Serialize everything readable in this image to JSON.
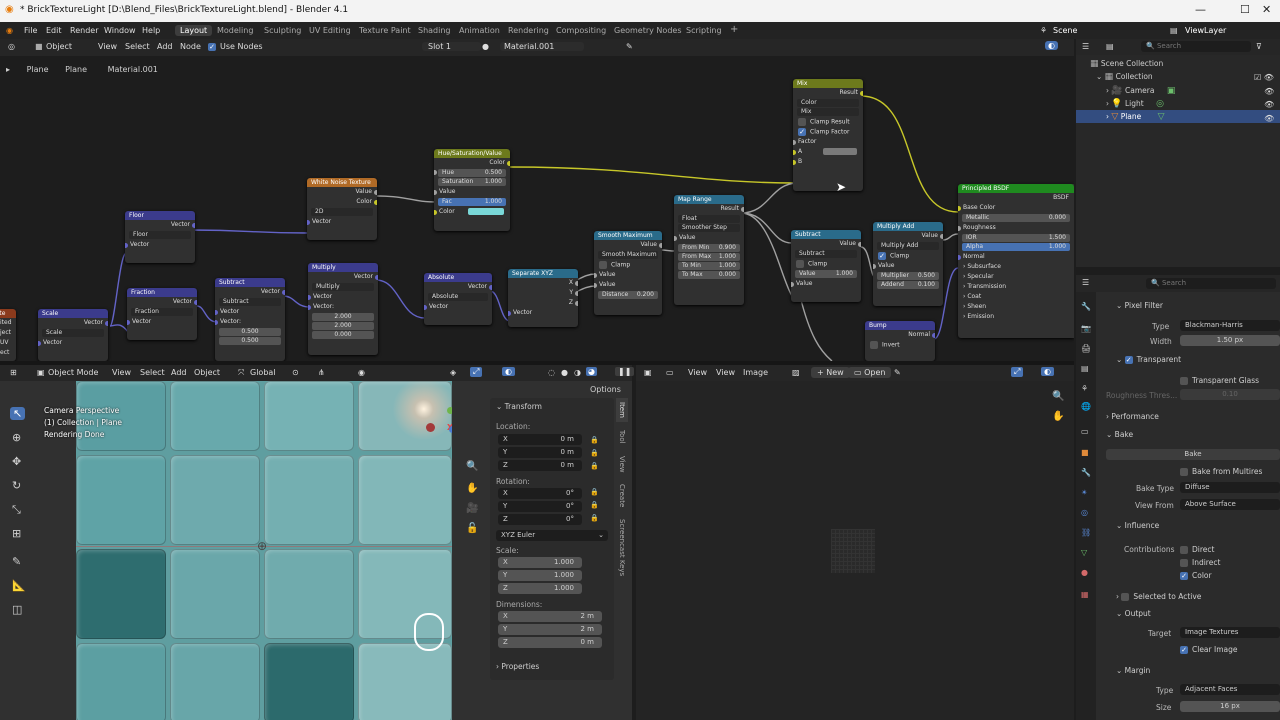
{
  "title_bar": {
    "title": "* BrickTextureLight [D:\\Blend_Files\\BrickTextureLight.blend] - Blender 4.1",
    "minimize": "—",
    "maximize": "☐",
    "close": "✕"
  },
  "menu": {
    "items": [
      "File",
      "Edit",
      "Render",
      "Window",
      "Help"
    ],
    "workspaces": [
      "Layout",
      "Modeling",
      "Sculpting",
      "UV Editing",
      "Texture Paint",
      "Shading",
      "Animation",
      "Rendering",
      "Compositing",
      "Geometry Nodes",
      "Scripting"
    ],
    "active_workspace": "Layout",
    "add_workspace": "+",
    "scene": "Scene",
    "view_layer": "ViewLayer"
  },
  "node_header": {
    "editor_type": "Object",
    "menus": [
      "View",
      "Select",
      "Add",
      "Node"
    ],
    "use_nodes_label": "Use Nodes",
    "slot": "Slot 1",
    "material": "Material.001"
  },
  "breadcrumb": {
    "items": [
      "Plane",
      "Plane",
      "Material.001"
    ]
  },
  "nodes": {
    "mix": {
      "title": "Mix",
      "result": "Result",
      "color": "Color",
      "mix": "Mix",
      "clamp_result": "Clamp Result",
      "clamp_factor": "Clamp Factor",
      "factor": "Factor",
      "a": "A",
      "b": "B"
    },
    "hsv": {
      "title": "Hue/Saturation/Value",
      "color_out": "Color",
      "hue": "Hue",
      "hue_v": "0.500",
      "sat": "Saturation",
      "sat_v": "1.000",
      "value": "Value",
      "fac": "Fac",
      "fac_v": "1.000",
      "color_in": "Color"
    },
    "white_noise": {
      "title": "White Noise Texture",
      "value": "Value",
      "color": "Color",
      "dim": "2D",
      "vector": "Vector"
    },
    "floor": {
      "title": "Floor",
      "vector_out": "Vector",
      "op": "Floor",
      "vector": "Vector"
    },
    "fraction": {
      "title": "Fraction",
      "vector_out": "Vector",
      "op": "Fraction",
      "vector": "Vector"
    },
    "subtract1": {
      "title": "Subtract",
      "vector_out": "Vector",
      "op": "Subtract",
      "vector": "Vector",
      "vector2": "Vector:",
      "v1": "0.500",
      "v2": "0.500"
    },
    "multiply": {
      "title": "Multiply",
      "vector_out": "Vector",
      "op": "Multiply",
      "vector": "Vector",
      "vector2": "Vector:",
      "v1": "2.000",
      "v2": "2.000",
      "v3": "0.000"
    },
    "absolute": {
      "title": "Absolute",
      "vector_out": "Vector",
      "op": "Absolute",
      "vector": "Vector"
    },
    "separate": {
      "title": "Separate XYZ",
      "x": "X",
      "y": "Y",
      "z": "Z",
      "vector": "Vector"
    },
    "smooth_max": {
      "title": "Smooth Maximum",
      "value_out": "Value",
      "op": "Smooth Maximum",
      "clamp": "Clamp",
      "value1": "Value",
      "value2": "Value",
      "distance": "Distance",
      "distance_v": "0.200"
    },
    "map_range": {
      "title": "Map Range",
      "result": "Result",
      "type": "Float",
      "interp": "Smoother Step",
      "value": "Value",
      "from_min": "From Min",
      "from_min_v": "0.900",
      "from_max": "From Max",
      "from_max_v": "1.000",
      "to_min": "To Min",
      "to_min_v": "1.000",
      "to_max": "To Max",
      "to_max_v": "0.000"
    },
    "subtract2": {
      "title": "Subtract",
      "value_out": "Value",
      "op": "Subtract",
      "clamp": "Clamp",
      "value": "Value",
      "value_v": "1.000",
      "value2": "Value"
    },
    "multiply_add": {
      "title": "Multiply Add",
      "value_out": "Value",
      "op": "Multiply Add",
      "clamp": "Clamp",
      "value": "Value",
      "mult": "Multiplier",
      "mult_v": "0.500",
      "addend": "Addend",
      "addend_v": "0.100"
    },
    "bump": {
      "title": "Bump",
      "normal": "Normal",
      "invert": "Invert"
    },
    "bsdf": {
      "title": "Principled BSDF",
      "bsdf": "BSDF",
      "base_color": "Base Color",
      "metallic": "Metallic",
      "metallic_v": "0.000",
      "roughness": "Roughness",
      "ior": "IOR",
      "ior_v": "1.500",
      "alpha": "Alpha",
      "alpha_v": "1.000",
      "normal": "Normal",
      "subsurface": "Subsurface",
      "specular": "Specular",
      "transmission": "Transmission",
      "coat": "Coat",
      "sheen": "Sheen",
      "emission": "Emission"
    },
    "scale": {
      "title": "Scale",
      "vector_out": "Vector",
      "op": "Scale",
      "vector": "Vector"
    },
    "partial": {
      "l1": "iate",
      "l2": "ited",
      "l3": "ject",
      "l4": "UV",
      "l5": "ect"
    }
  },
  "viewport": {
    "mode": "Object Mode",
    "menus": [
      "View",
      "Select",
      "Add",
      "Object"
    ],
    "orientation": "Global",
    "options": "Options",
    "info1": "Camera Perspective",
    "info2": "(1) Collection | Plane",
    "info3": "Rendering Done"
  },
  "npanel": {
    "transform": "Transform",
    "location": "Location:",
    "rotation": "Rotation:",
    "scale": "Scale:",
    "dimensions": "Dimensions:",
    "x": "X",
    "y": "Y",
    "z": "Z",
    "loc": [
      "0 m",
      "0 m",
      "0 m"
    ],
    "rot": [
      "0°",
      "0°",
      "0°"
    ],
    "euler": "XYZ Euler",
    "scl": [
      "1.000",
      "1.000",
      "1.000"
    ],
    "dim": [
      "2 m",
      "2 m",
      "0 m"
    ],
    "properties": "Properties",
    "tabs": [
      "Item",
      "Tool",
      "View",
      "Create",
      "Screencast Keys"
    ]
  },
  "image_editor": {
    "menus": [
      "View",
      "View",
      "Image"
    ],
    "new": "New",
    "open": "Open"
  },
  "outliner": {
    "search": "Search",
    "scene_collection": "Scene Collection",
    "collection": "Collection",
    "items": [
      "Camera",
      "Light",
      "Plane"
    ]
  },
  "properties": {
    "search": "Search",
    "pixel_filter": "Pixel Filter",
    "type_label": "Type",
    "type_value": "Blackman-Harris",
    "width_label": "Width",
    "width_value": "1.50 px",
    "transparent": "Transparent",
    "transparent_glass": "Transparent Glass",
    "roughness_thresh": "Roughness Thres...",
    "roughness_thresh_v": "0.10",
    "performance": "Performance",
    "bake": "Bake",
    "bake_button": "Bake",
    "bake_from_multires": "Bake from Multires",
    "bake_type_label": "Bake Type",
    "bake_type": "Diffuse",
    "view_from_label": "View From",
    "view_from": "Above Surface",
    "influence": "Influence",
    "contributions": "Contributions",
    "direct": "Direct",
    "indirect": "Indirect",
    "color": "Color",
    "selected_to_active": "Selected to Active",
    "output": "Output",
    "target_label": "Target",
    "target": "Image Textures",
    "clear_image": "Clear Image",
    "margin": "Margin",
    "margin_type_label": "Type",
    "margin_type": "Adjacent Faces",
    "size_label": "Size",
    "size": "16 px"
  },
  "colors": {
    "accent": "#4772b3",
    "shader_header": "#1f8a1f",
    "input_header": "#8b3a1c",
    "vector_header": "#3b3b8c",
    "color_header": "#6d7a1c",
    "converter_header": "#2a6b8a",
    "texture_header": "#b06a26"
  }
}
